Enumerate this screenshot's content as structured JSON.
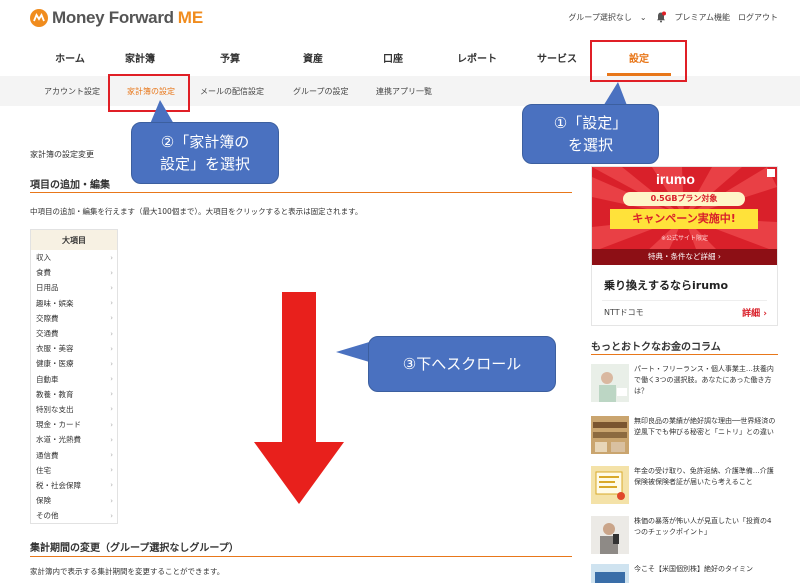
{
  "header": {
    "logo_text": "Money Forward",
    "logo_me": "ME",
    "group_select": "グループ選択なし",
    "premium": "プレミアム機能",
    "logout": "ログアウト"
  },
  "nav": [
    {
      "label": "ホーム"
    },
    {
      "label": "家計簿"
    },
    {
      "label": "予算"
    },
    {
      "label": "資産"
    },
    {
      "label": "口座"
    },
    {
      "label": "レポート"
    },
    {
      "label": "サービス"
    },
    {
      "label": "設定"
    }
  ],
  "subnav": [
    {
      "label": "アカウント設定"
    },
    {
      "label": "家計簿の設定"
    },
    {
      "label": "メールの配信設定"
    },
    {
      "label": "グループの設定"
    },
    {
      "label": "連携アプリ一覧"
    }
  ],
  "callouts": {
    "c1": "①「設定」\nを選択",
    "c2": "②「家計簿の\n設定」を選択",
    "c3": "③下へスクロール"
  },
  "content": {
    "breadcrumb": "家計簿の設定変更",
    "section1_title": "項目の追加・編集",
    "section1_desc": "中項目の追加・編集を行えます（最大100個まで）。大項目をクリックすると表示は固定されます。",
    "table_header": "大項目",
    "categories": [
      "収入",
      "食費",
      "日用品",
      "趣味・娯楽",
      "交際費",
      "交通費",
      "衣服・美容",
      "健康・医療",
      "自動車",
      "教養・教育",
      "特別な支出",
      "現金・カード",
      "水道・光熱費",
      "通信費",
      "住宅",
      "税・社会保障",
      "保険",
      "その他"
    ],
    "section2_title": "集計期間の変更（グループ選択なしグループ）",
    "section2_desc": "家計簿内で表示する集計期間を変更することができます。"
  },
  "ad": {
    "brand": "irumo",
    "pill": "0.5GBプラン対象",
    "campaign": "キャンペーン実施中!",
    "small": "※公式サイト限定",
    "band": "特典・条件など詳細 ›",
    "headline": "乗り換えするならirumo",
    "advertiser": "NTTドコモ",
    "detail": "詳細 ›"
  },
  "column": {
    "title": "もっとおトクなお金のコラム",
    "items": [
      {
        "text": "パート・フリーランス・個人事業主…扶養内で働く3つの選択肢。あなたにあった働き方は？"
      },
      {
        "text": "無印良品の業績が絶好調な理由──世界経済の逆風下でも伸びる秘密と「ニトリ」との違い"
      },
      {
        "text": "年金の受け取り、免許返納、介護準備…介護保険被保険者証が届いたら考えること"
      },
      {
        "text": "株価の暴落が怖い人が見直したい「投資の4つのチェックポイント」"
      },
      {
        "text": "今こそ【米国個別株】絶好のタイミン"
      }
    ]
  },
  "colors": {
    "accent": "#e8771a",
    "highlight": "#e01f26",
    "callout": "#4a71c0",
    "arrow": "#e8201c"
  }
}
